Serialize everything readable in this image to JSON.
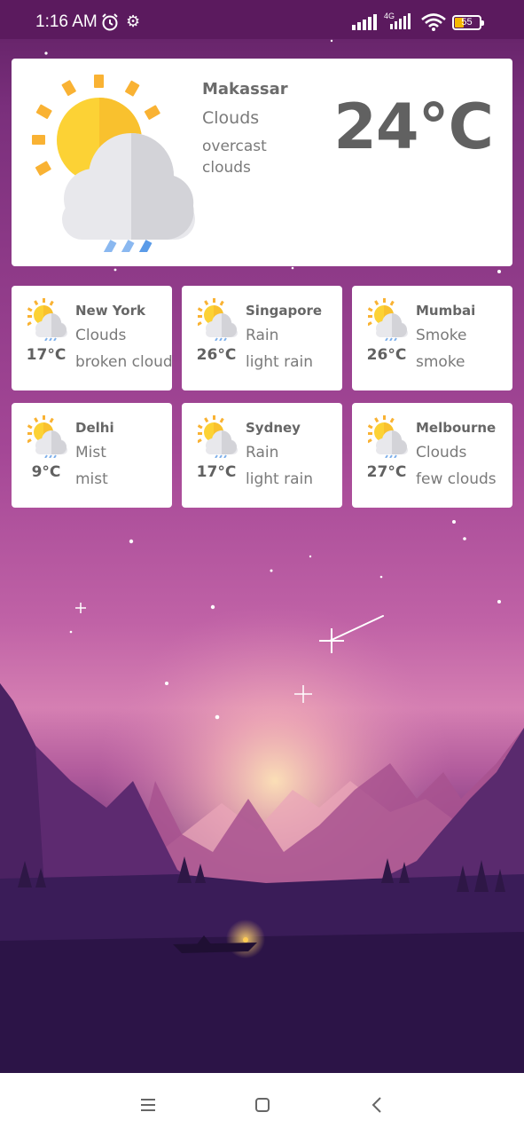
{
  "status_bar": {
    "time": "1:16 AM",
    "network": "4G",
    "battery": "55",
    "icons": [
      "alarm-icon",
      "gear-icon",
      "signal-icon",
      "wifi-icon",
      "battery-icon"
    ]
  },
  "main_weather": {
    "city": "Makassar",
    "condition": "Clouds",
    "description": "overcast clouds",
    "temperature": "24°C",
    "icon": "sun-cloud-rain-icon"
  },
  "cities": [
    {
      "name": "New York",
      "condition": "Clouds",
      "description": "broken clouds",
      "temperature": "17°C",
      "icon": "sun-cloud-rain-icon"
    },
    {
      "name": "Singapore",
      "condition": "Rain",
      "description": "light rain",
      "temperature": "26°C",
      "icon": "sun-cloud-rain-icon"
    },
    {
      "name": "Mumbai",
      "condition": "Smoke",
      "description": "smoke",
      "temperature": "26°C",
      "icon": "sun-cloud-rain-icon"
    },
    {
      "name": "Delhi",
      "condition": "Mist",
      "description": "mist",
      "temperature": "9°C",
      "icon": "sun-cloud-rain-icon"
    },
    {
      "name": "Sydney",
      "condition": "Rain",
      "description": "light rain",
      "temperature": "17°C",
      "icon": "sun-cloud-rain-icon"
    },
    {
      "name": "Melbourne",
      "condition": "Clouds",
      "description": "few clouds",
      "temperature": "27°C",
      "icon": "sun-cloud-rain-icon"
    }
  ],
  "nav_bar": {
    "icons": [
      "menu-icon",
      "home-icon",
      "back-icon"
    ]
  },
  "colors": {
    "status_bar": "#5b1a5e",
    "card_bg": "#ffffff",
    "text_dark": "#616161",
    "sun": "#f9c12e"
  }
}
